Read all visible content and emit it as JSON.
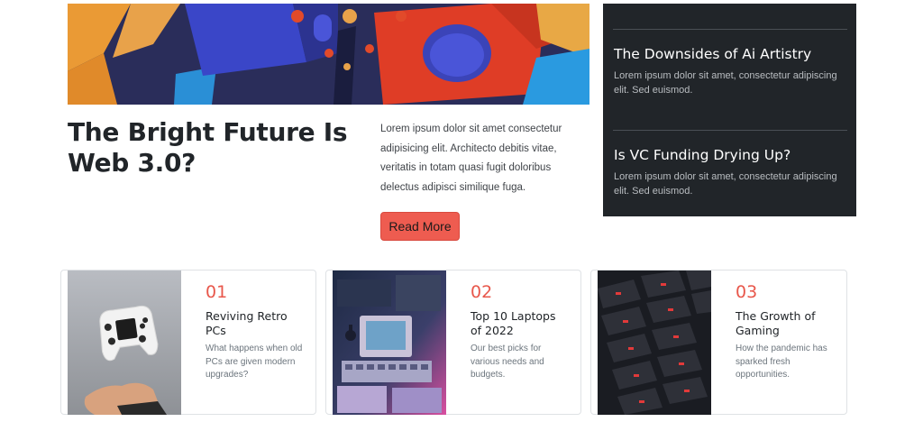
{
  "hero": {
    "image_alt": "colorful abstract 3d blocks",
    "title": "The Bright Future Is Web 3.0?",
    "text": "Lorem ipsum dolor sit amet consectetur adipisicing elit. Architecto debitis vitae, veritatis in totam quasi fugit doloribus delectus adipisci similique fuga.",
    "button_label": "Read More"
  },
  "sidebar": {
    "items": [
      {
        "title": "The Downsides of Ai Artistry",
        "text": "Lorem ipsum dolor sit amet, consectetur adipiscing elit. Sed euismod."
      },
      {
        "title": "Is VC Funding Drying Up?",
        "text": "Lorem ipsum dolor sit amet, consectetur adipiscing elit. Sed euismod."
      }
    ]
  },
  "cards": [
    {
      "number": "01",
      "title": "Reviving Retro PCs",
      "text": "What happens when old PCs are given modern upgrades?",
      "image": "game-controller"
    },
    {
      "number": "02",
      "title": "Top 10 Laptops of 2022",
      "text": "Our best picks for various needs and budgets.",
      "image": "retro-computer"
    },
    {
      "number": "03",
      "title": "The Growth of Gaming",
      "text": "How the pandemic has sparked fresh opportunities.",
      "image": "red-keyboard"
    }
  ],
  "colors": {
    "accent": "#ee5c50",
    "sidebar_bg": "#212529",
    "number_color": "#e8574b"
  }
}
